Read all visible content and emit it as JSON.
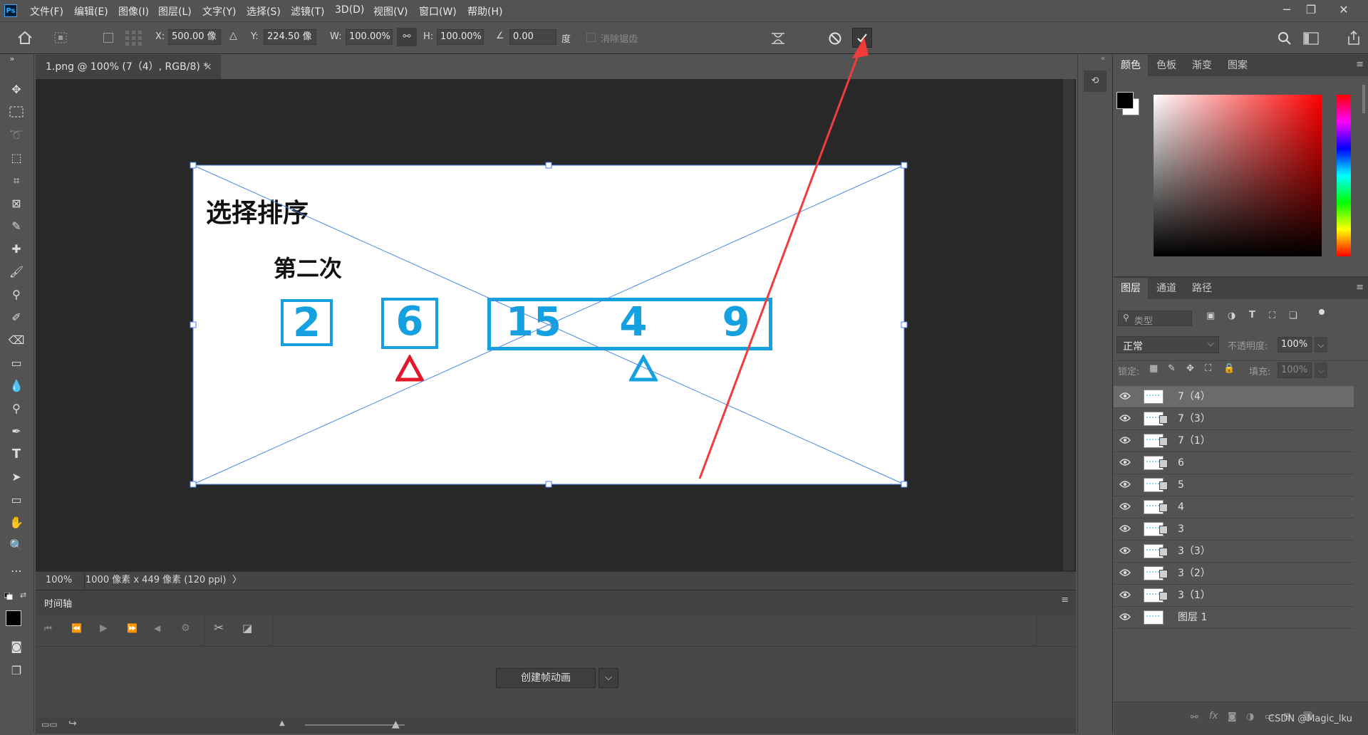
{
  "menu": {
    "logo": "Ps",
    "items": [
      "文件(F)",
      "编辑(E)",
      "图像(I)",
      "图层(L)",
      "文字(Y)",
      "选择(S)",
      "滤镜(T)",
      "3D(D)",
      "视图(V)",
      "窗口(W)",
      "帮助(H)"
    ],
    "window_controls": [
      "minimize",
      "restore",
      "close"
    ]
  },
  "options": {
    "x_label": "X:",
    "x_value": "500.00 像",
    "y_label": "Y:",
    "y_value": "224.50 像",
    "w_label": "W:",
    "w_value": "100.00%",
    "h_label": "H:",
    "h_value": "100.00%",
    "angle_value": "0.00",
    "angle_unit": "度",
    "antialias_label": "消除锯齿"
  },
  "document": {
    "tab_title": "1.png @ 100% (7（4）, RGB/8) *",
    "tab_close": "×",
    "zoom": "100%",
    "doc_info": "1000 像素 x 449 像素 (120 ppi)",
    "status_arrow": "〉"
  },
  "canvas": {
    "title": "选择排序",
    "subtitle": "第二次",
    "numbers": [
      "2",
      "6",
      "15",
      "4",
      "9"
    ],
    "colors": {
      "blue": "#15a0e0",
      "red": "#e0182a",
      "guide": "#4a86e8",
      "arrow": "#f23c3c"
    }
  },
  "timeline": {
    "title": "时间轴",
    "create_button": "创建帧动画"
  },
  "panels": {
    "color_tabs": [
      "颜色",
      "色板",
      "渐变",
      "图案"
    ],
    "layer_tabs": [
      "图层",
      "通道",
      "路径"
    ],
    "filter_placeholder": "类型",
    "blend_mode": "正常",
    "opacity_label": "不透明度:",
    "opacity_value": "100%",
    "lock_label": "锁定:",
    "fill_label": "填充:",
    "fill_value": "100%",
    "layers": [
      {
        "name": "7（4）",
        "selected": true,
        "smart": false
      },
      {
        "name": "7（3）",
        "selected": false,
        "smart": true
      },
      {
        "name": "7（1）",
        "selected": false,
        "smart": true
      },
      {
        "name": "6",
        "selected": false,
        "smart": true
      },
      {
        "name": "5",
        "selected": false,
        "smart": true
      },
      {
        "name": "4",
        "selected": false,
        "smart": true
      },
      {
        "name": "3",
        "selected": false,
        "smart": true
      },
      {
        "name": "3（3）",
        "selected": false,
        "smart": true
      },
      {
        "name": "3（2）",
        "selected": false,
        "smart": true
      },
      {
        "name": "3（1）",
        "selected": false,
        "smart": true
      },
      {
        "name": "图层 1",
        "selected": false,
        "smart": false
      }
    ]
  },
  "watermark": "CSDN @Magic_lku"
}
